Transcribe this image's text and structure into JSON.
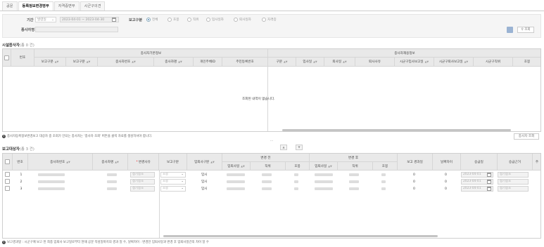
{
  "tabs": [
    "공문",
    "등록정보변경명부",
    "자격증변부",
    "시군구의견"
  ],
  "search": {
    "period_label": "기간",
    "period_type": "발령일",
    "date_range": "2023-04-01 ~ 2023-04-30",
    "report_type_label": "보고구분",
    "report_types": [
      "전체",
      "호봉",
      "직위",
      "입사일자",
      "퇴사일자",
      "자격증"
    ],
    "worker_name_label": "종사자명",
    "search_button": "조회"
  },
  "facility": {
    "title": "시설종사자",
    "count": "(총 0 건)",
    "group_basic": "종사자기본정보",
    "group_employment": "종사자재용정보",
    "headers_left": [
      "번호",
      "보고구분",
      "보고구분",
      "종사자번호",
      "종사자명",
      "개인주체ID",
      "주민등록번호"
    ],
    "headers_right": [
      "구분",
      "입사일",
      "퇴사일",
      "퇴사사유",
      "시군구입사보고일",
      "시군구퇴사보고일",
      "시군구직위",
      "호봉"
    ],
    "empty_message": "조회된 내역이 없습니다."
  },
  "note1": "종사자등록정보변경보고 대상자 중 조회가 안되는 종사자는 '종사자 조회' 버튼을 클릭 자료를 생성하셔야 합니다.",
  "worker_search_button": "종사자 조회",
  "report": {
    "title": "보고대상자",
    "count": "(총 3 건)",
    "headers": [
      "번호",
      "종사자번호",
      "종사자명",
      "변경사유",
      "보고구분",
      "입퇴사구분",
      "변경 전",
      "변경 후",
      "보고 경과일",
      "날짜차이",
      "승급일",
      "승급근거",
      "주"
    ],
    "sub_before": [
      "입퇴사일",
      "직위",
      "호봉"
    ],
    "sub_after": [
      "입퇴사일",
      "직위",
      "호봉"
    ],
    "rows": [
      {
        "no": "1",
        "reason": "정기승호",
        "type": "호봉",
        "io": "입사",
        "elapsed": "0",
        "diff": "0",
        "promo_date": "2023-04-01",
        "basis": "정기승호"
      },
      {
        "no": "2",
        "reason": "정기승호",
        "type": "호봉",
        "io": "입사",
        "elapsed": "0",
        "diff": "0",
        "promo_date": "2023-04-01",
        "basis": "정기승호"
      },
      {
        "no": "3",
        "reason": "정기승호",
        "type": "호봉",
        "io": "입사",
        "elapsed": "0",
        "diff": "0",
        "promo_date": "2023-04-01",
        "basis": "정기승호"
      }
    ]
  },
  "note2": "보고경과일 : 시군구에 보고 된 최종 입퇴사 보고일로부터 현재 공문 작성일까지의 경과 일 수, 날짜차이 : 변경전 입퇴사일과 변경 후 입퇴사일간의 차이 일 수"
}
